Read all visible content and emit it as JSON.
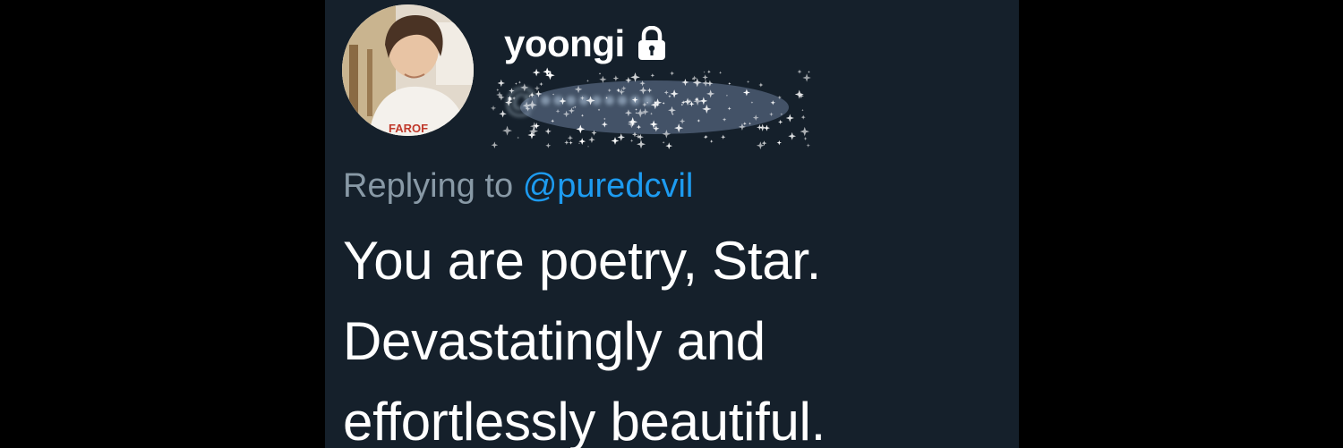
{
  "profile": {
    "display_name": "yoongi",
    "handle": "@•••••••••",
    "protected_icon": "lock-icon",
    "avatar_icon": "profile-photo"
  },
  "reply": {
    "prefix": "Replying to",
    "mention": "@puredcvil"
  },
  "tweet": {
    "lines": [
      "You are poetry, Star.",
      "Devastatingly and",
      "effortlessly beautiful."
    ]
  },
  "colors": {
    "background": "#000000",
    "card": "#15202b",
    "text": "#ffffff",
    "muted": "#8899a6",
    "link": "#1d9bf0"
  }
}
